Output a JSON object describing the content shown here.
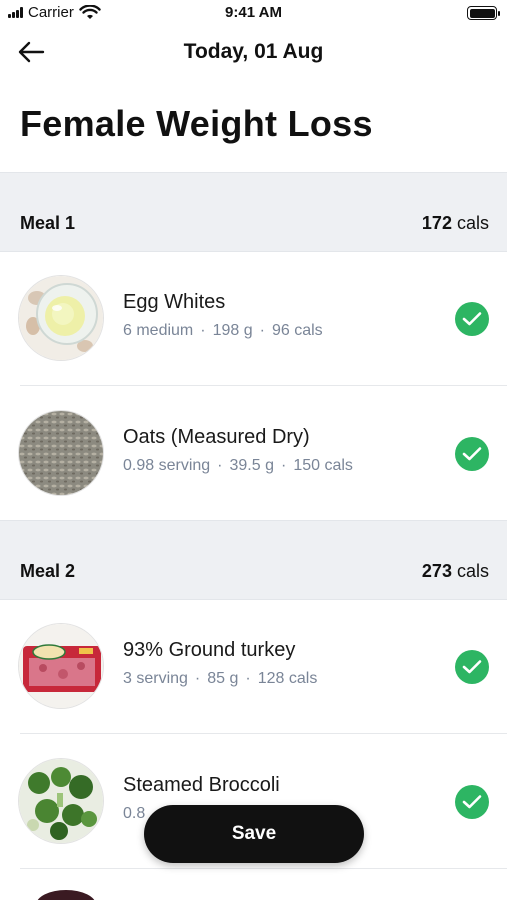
{
  "status_bar": {
    "carrier": "Carrier",
    "time": "9:41 AM",
    "icons": [
      "signal-icon",
      "wifi-icon",
      "battery-icon"
    ]
  },
  "nav": {
    "title": "Today, 01 Aug",
    "back_icon": "arrow-left-icon"
  },
  "page_title": "Female Weight Loss",
  "meals": [
    {
      "name": "Meal 1",
      "cals_value": "172",
      "cals_unit": "cals",
      "items": [
        {
          "name": "Egg Whites",
          "amount": "6 medium",
          "weight": "198 g",
          "cals": "96 cals",
          "checked": true,
          "image": "egg-whites-image"
        },
        {
          "name": "Oats (Measured Dry)",
          "amount": "0.98 serving",
          "weight": "39.5 g",
          "cals": "150 cals",
          "checked": true,
          "image": "oats-image"
        }
      ]
    },
    {
      "name": "Meal 2",
      "cals_value": "273",
      "cals_unit": "cals",
      "items": [
        {
          "name": "93% Ground turkey",
          "amount": "3 serving",
          "weight": "85 g",
          "cals": "128 cals",
          "checked": true,
          "image": "ground-turkey-image"
        },
        {
          "name": "Steamed Broccoli",
          "amount": "0.8",
          "checked": true,
          "image": "broccoli-image"
        }
      ]
    }
  ],
  "save_button": {
    "label": "Save"
  },
  "colors": {
    "check_green": "#2db563",
    "meta_gray": "#7a8597",
    "section_bg": "#eef0f3",
    "button_black": "#111111"
  }
}
